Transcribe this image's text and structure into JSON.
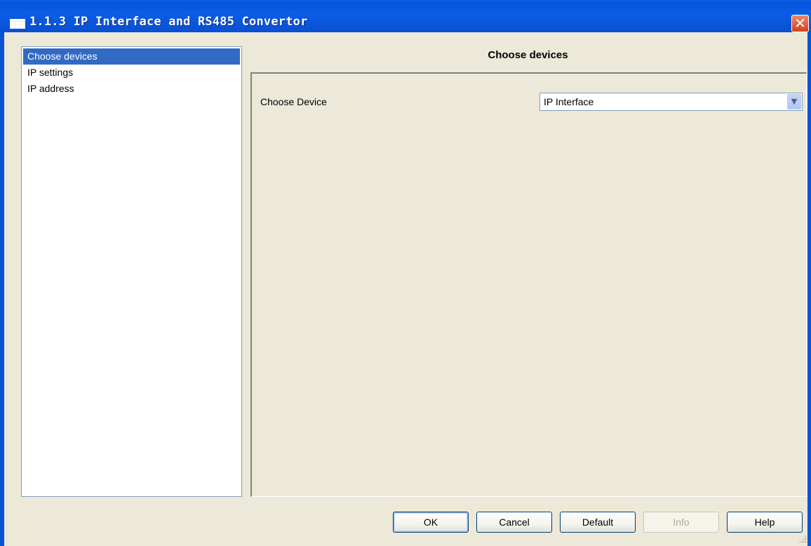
{
  "window": {
    "title": "1.1.3 IP Interface and RS485 Convertor",
    "close_glyph": "✕"
  },
  "nav": {
    "items": [
      {
        "label": "Choose devices",
        "selected": true
      },
      {
        "label": "IP settings",
        "selected": false
      },
      {
        "label": "IP address",
        "selected": false
      }
    ]
  },
  "main": {
    "section_title": "Choose devices",
    "fields": [
      {
        "label": "Choose Device",
        "value": "IP Interface"
      }
    ]
  },
  "buttons": {
    "ok": "OK",
    "cancel": "Cancel",
    "default": "Default",
    "info": "Info",
    "help": "Help"
  },
  "colors": {
    "titlebar": "#0a5ee6",
    "selection": "#316ac5",
    "dialog_bg": "#ece9d8",
    "close_button": "#d2401c"
  },
  "icons": {
    "close": "close-icon",
    "dropdown": "chevron-down-icon",
    "window": "window-icon"
  }
}
